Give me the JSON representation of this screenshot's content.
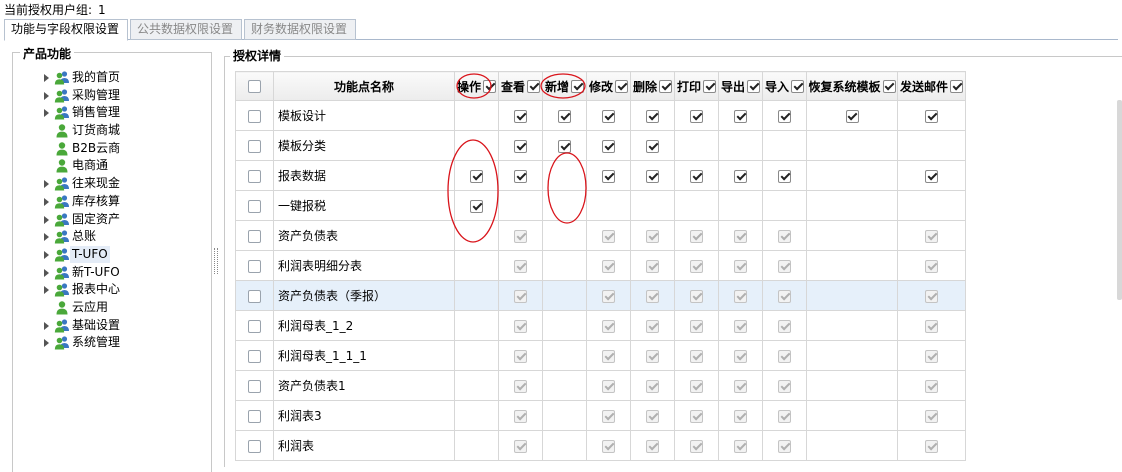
{
  "user_group": {
    "label": "当前授权用户组:",
    "value": "1"
  },
  "tabs": [
    {
      "label": "功能与字段权限设置",
      "active": true
    },
    {
      "label": "公共数据权限设置",
      "active": false
    },
    {
      "label": "财务数据权限设置",
      "active": false
    }
  ],
  "product_panel": {
    "legend": "产品功能",
    "items": [
      {
        "label": "我的首页",
        "expandable": true,
        "icon": "group-users-icon"
      },
      {
        "label": "采购管理",
        "expandable": true,
        "icon": "group-users-icon"
      },
      {
        "label": "销售管理",
        "expandable": true,
        "icon": "group-users-icon"
      },
      {
        "label": "订货商城",
        "expandable": false,
        "icon": "user-icon"
      },
      {
        "label": "B2B云商",
        "expandable": false,
        "icon": "user-icon"
      },
      {
        "label": "电商通",
        "expandable": false,
        "icon": "user-icon"
      },
      {
        "label": "往来现金",
        "expandable": true,
        "icon": "group-users-icon"
      },
      {
        "label": "库存核算",
        "expandable": true,
        "icon": "group-users-icon"
      },
      {
        "label": "固定资产",
        "expandable": true,
        "icon": "group-users-icon"
      },
      {
        "label": "总账",
        "expandable": true,
        "icon": "group-users-icon"
      },
      {
        "label": "T-UFO",
        "expandable": true,
        "icon": "group-users-icon",
        "selected": true
      },
      {
        "label": "新T-UFO",
        "expandable": true,
        "icon": "group-users-icon"
      },
      {
        "label": "报表中心",
        "expandable": true,
        "icon": "group-users-icon"
      },
      {
        "label": "云应用",
        "expandable": false,
        "icon": "user-icon"
      },
      {
        "label": "基础设置",
        "expandable": true,
        "icon": "group-users-icon"
      },
      {
        "label": "系统管理",
        "expandable": true,
        "icon": "group-users-icon"
      }
    ]
  },
  "auth_panel": {
    "legend": "授权详情",
    "columns": [
      {
        "label": "功能点名称"
      },
      {
        "label": "操作",
        "checked": true
      },
      {
        "label": "查看",
        "checked": true
      },
      {
        "label": "新增",
        "checked": true
      },
      {
        "label": "修改",
        "checked": true
      },
      {
        "label": "删除",
        "checked": true
      },
      {
        "label": "打印",
        "checked": true
      },
      {
        "label": "导出",
        "checked": true
      },
      {
        "label": "导入",
        "checked": true
      },
      {
        "label": "恢复系统模板",
        "checked": true
      },
      {
        "label": "发送邮件",
        "checked": true
      }
    ],
    "cell_legend": {
      "c": "checked",
      "d": "disabled-checked",
      "-": "empty"
    },
    "rows": [
      {
        "name": "模板设计",
        "cells": [
          "-",
          "c",
          "c",
          "c",
          "c",
          "c",
          "c",
          "c",
          "c",
          "c"
        ]
      },
      {
        "name": "模板分类",
        "cells": [
          "-",
          "c",
          "c",
          "c",
          "c",
          "-",
          "-",
          "-",
          "-",
          "-"
        ]
      },
      {
        "name": "报表数据",
        "cells": [
          "c",
          "c",
          "-",
          "c",
          "c",
          "c",
          "c",
          "c",
          "-",
          "c"
        ]
      },
      {
        "name": "一键报税",
        "cells": [
          "c",
          "-",
          "-",
          "-",
          "-",
          "-",
          "-",
          "-",
          "-",
          "-"
        ]
      },
      {
        "name": "资产负债表",
        "cells": [
          "-",
          "d",
          "-",
          "d",
          "d",
          "d",
          "d",
          "d",
          "-",
          "d"
        ]
      },
      {
        "name": "利润表明细分表",
        "cells": [
          "-",
          "d",
          "-",
          "d",
          "d",
          "d",
          "d",
          "d",
          "-",
          "d"
        ]
      },
      {
        "name": "资产负债表（季报）",
        "cells": [
          "-",
          "d",
          "-",
          "d",
          "d",
          "d",
          "d",
          "d",
          "-",
          "d"
        ],
        "highlight": true
      },
      {
        "name": "利润母表_1_2",
        "cells": [
          "-",
          "d",
          "-",
          "d",
          "d",
          "d",
          "d",
          "d",
          "-",
          "d"
        ]
      },
      {
        "name": "利润母表_1_1_1",
        "cells": [
          "-",
          "d",
          "-",
          "d",
          "d",
          "d",
          "d",
          "d",
          "-",
          "d"
        ]
      },
      {
        "name": "资产负债表1",
        "cells": [
          "-",
          "d",
          "-",
          "d",
          "d",
          "d",
          "d",
          "d",
          "-",
          "d"
        ]
      },
      {
        "name": "利润表3",
        "cells": [
          "-",
          "d",
          "-",
          "d",
          "d",
          "d",
          "d",
          "d",
          "-",
          "d"
        ]
      },
      {
        "name": "利润表",
        "cells": [
          "-",
          "d",
          "-",
          "d",
          "d",
          "d",
          "d",
          "d",
          "-",
          "d"
        ]
      }
    ]
  },
  "annotation_color": "#d9141b",
  "icon_colors": {
    "user_green": "#4aa83a",
    "user_blue": "#3a78c2"
  }
}
